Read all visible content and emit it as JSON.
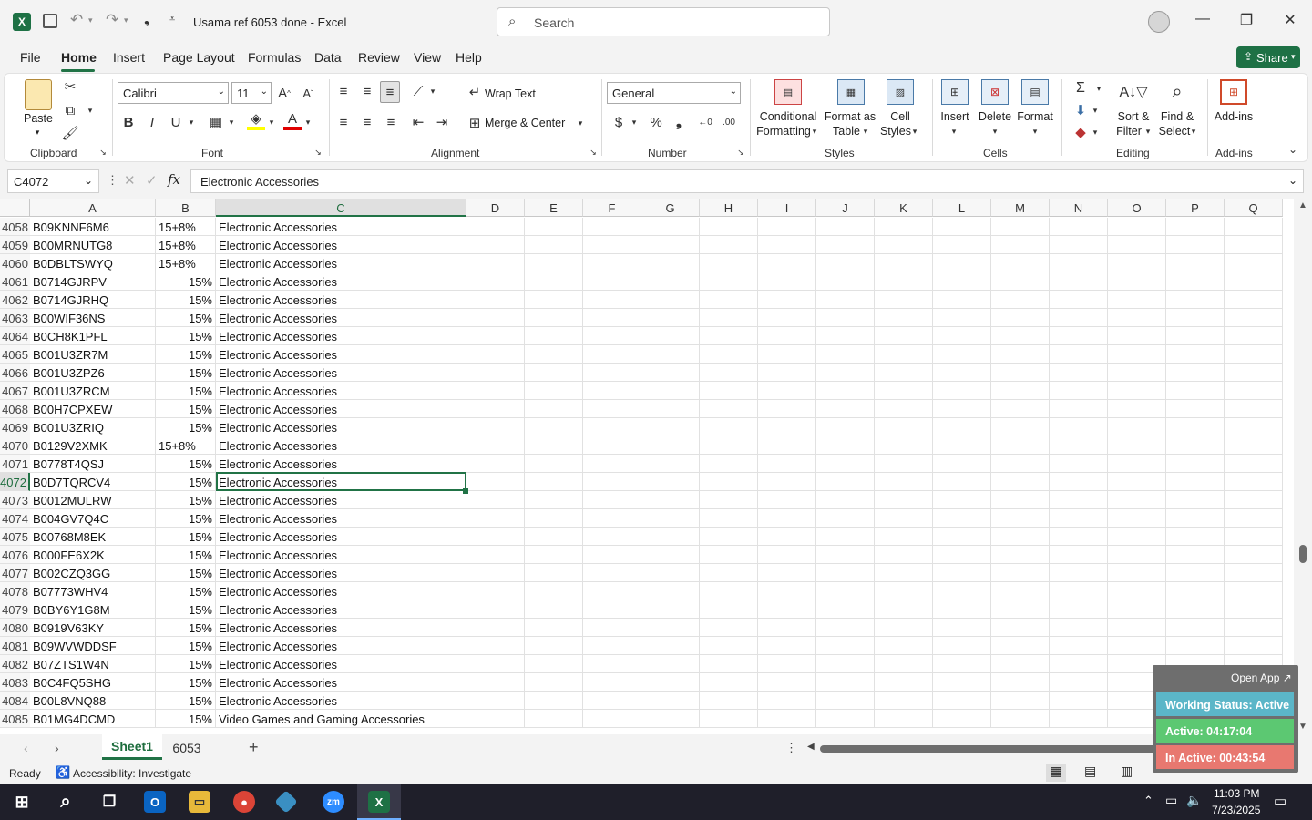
{
  "window": {
    "title": "Usama ref 6053 done  -  Excel",
    "search_placeholder": "Search"
  },
  "menu": {
    "tabs": [
      "File",
      "Home",
      "Insert",
      "Page Layout",
      "Formulas",
      "Data",
      "Review",
      "View",
      "Help"
    ],
    "share_label": "Share"
  },
  "ribbon": {
    "clipboard": {
      "paste": "Paste",
      "group": "Clipboard"
    },
    "font": {
      "name": "Calibri",
      "size": "11",
      "group": "Font",
      "bold": "B",
      "italic": "I",
      "underline": "U"
    },
    "alignment": {
      "wrap": "Wrap Text",
      "merge": "Merge & Center",
      "group": "Alignment"
    },
    "number": {
      "format": "General",
      "group": "Number"
    },
    "styles": {
      "conditional": [
        "Conditional",
        "Formatting"
      ],
      "format_table": [
        "Format as",
        "Table"
      ],
      "cell_styles": [
        "Cell",
        "Styles"
      ],
      "group": "Styles"
    },
    "cells": {
      "insert": "Insert",
      "delete": "Delete",
      "format": "Format",
      "group": "Cells"
    },
    "editing": {
      "sort": [
        "Sort &",
        "Filter"
      ],
      "find": [
        "Find &",
        "Select"
      ],
      "group": "Editing"
    },
    "addins": {
      "label": "Add-ins",
      "group": "Add-ins"
    }
  },
  "formula_bar": {
    "name_box": "C4072",
    "value": "Electronic Accessories"
  },
  "columns": [
    "A",
    "B",
    "C",
    "D",
    "E",
    "F",
    "G",
    "H",
    "I",
    "J",
    "K",
    "L",
    "M",
    "N",
    "O",
    "P",
    "Q"
  ],
  "rows": [
    {
      "n": "4058",
      "a": "B09KNNF6M6",
      "b": "15+8%",
      "c": "Electronic Accessories"
    },
    {
      "n": "4059",
      "a": "B00MRNUTG8",
      "b": "15+8%",
      "c": "Electronic Accessories"
    },
    {
      "n": "4060",
      "a": "B0DBLTSWYQ",
      "b": "15+8%",
      "c": "Electronic Accessories"
    },
    {
      "n": "4061",
      "a": "B0714GJRPV",
      "b": "15%",
      "c": "Electronic Accessories"
    },
    {
      "n": "4062",
      "a": "B0714GJRHQ",
      "b": "15%",
      "c": "Electronic Accessories"
    },
    {
      "n": "4063",
      "a": "B00WIF36NS",
      "b": "15%",
      "c": "Electronic Accessories"
    },
    {
      "n": "4064",
      "a": "B0CH8K1PFL",
      "b": "15%",
      "c": "Electronic Accessories"
    },
    {
      "n": "4065",
      "a": "B001U3ZR7M",
      "b": "15%",
      "c": "Electronic Accessories"
    },
    {
      "n": "4066",
      "a": "B001U3ZPZ6",
      "b": "15%",
      "c": "Electronic Accessories"
    },
    {
      "n": "4067",
      "a": "B001U3ZRCM",
      "b": "15%",
      "c": "Electronic Accessories"
    },
    {
      "n": "4068",
      "a": "B00H7CPXEW",
      "b": "15%",
      "c": "Electronic Accessories"
    },
    {
      "n": "4069",
      "a": "B001U3ZRIQ",
      "b": "15%",
      "c": "Electronic Accessories"
    },
    {
      "n": "4070",
      "a": "B0129V2XMK",
      "b": "15+8%",
      "c": "Electronic Accessories"
    },
    {
      "n": "4071",
      "a": "B0778T4QSJ",
      "b": "15%",
      "c": "Electronic Accessories"
    },
    {
      "n": "4072",
      "a": "B0D7TQRCV4",
      "b": "15%",
      "c": "Electronic Accessories"
    },
    {
      "n": "4073",
      "a": "B0012MULRW",
      "b": "15%",
      "c": "Electronic Accessories"
    },
    {
      "n": "4074",
      "a": "B004GV7Q4C",
      "b": "15%",
      "c": "Electronic Accessories"
    },
    {
      "n": "4075",
      "a": "B00768M8EK",
      "b": "15%",
      "c": "Electronic Accessories"
    },
    {
      "n": "4076",
      "a": "B000FE6X2K",
      "b": "15%",
      "c": "Electronic Accessories"
    },
    {
      "n": "4077",
      "a": "B002CZQ3GG",
      "b": "15%",
      "c": "Electronic Accessories"
    },
    {
      "n": "4078",
      "a": "B07773WHV4",
      "b": "15%",
      "c": "Electronic Accessories"
    },
    {
      "n": "4079",
      "a": "B0BY6Y1G8M",
      "b": "15%",
      "c": "Electronic Accessories"
    },
    {
      "n": "4080",
      "a": "B0919V63KY",
      "b": "15%",
      "c": "Electronic Accessories"
    },
    {
      "n": "4081",
      "a": "B09WVWDDSF",
      "b": "15%",
      "c": "Electronic Accessories"
    },
    {
      "n": "4082",
      "a": "B07ZTS1W4N",
      "b": "15%",
      "c": "Electronic Accessories"
    },
    {
      "n": "4083",
      "a": "B0C4FQ5SHG",
      "b": "15%",
      "c": "Electronic Accessories"
    },
    {
      "n": "4084",
      "a": "B00L8VNQ88",
      "b": "15%",
      "c": "Electronic Accessories"
    },
    {
      "n": "4085",
      "a": "B01MG4DCMD",
      "b": "15%",
      "c": "Video Games and Gaming Accessories"
    }
  ],
  "selected_row": "4072",
  "sheets": {
    "tabs": [
      "Sheet1",
      "6053"
    ],
    "active": "Sheet1"
  },
  "status": {
    "ready": "Ready",
    "accessibility": "Accessibility: Investigate"
  },
  "widget": {
    "open_app": "Open App ↗",
    "working_status": "Working Status: Active",
    "active_time": "Active: 04:17:04",
    "inactive_time": "In Active: 00:43:54",
    "colors": {
      "status": "#5bb6c8",
      "active": "#5cc872",
      "inactive": "#e87870"
    }
  },
  "taskbar": {
    "time": "11:03 PM",
    "date": "7/23/2025"
  },
  "accent_color": "#217346"
}
